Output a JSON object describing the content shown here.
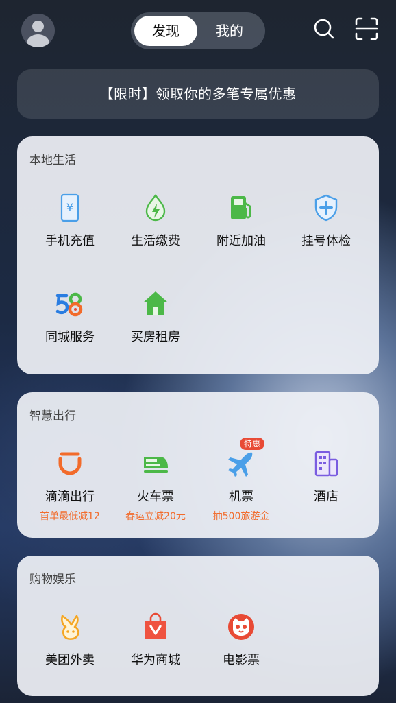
{
  "top": {
    "tabs": [
      {
        "label": "发现",
        "active": true
      },
      {
        "label": "我的",
        "active": false
      }
    ]
  },
  "promo": {
    "text": "【限时】领取你的多笔专属优惠"
  },
  "local": {
    "title": "本地生活",
    "items": [
      {
        "label": "手机充值",
        "icon": "phone-recharge-icon"
      },
      {
        "label": "生活缴费",
        "icon": "utility-payment-icon"
      },
      {
        "label": "附近加油",
        "icon": "gas-station-icon"
      },
      {
        "label": "挂号体检",
        "icon": "medical-shield-icon"
      },
      {
        "label": "同城服务",
        "icon": "58-logo-icon"
      },
      {
        "label": "买房租房",
        "icon": "house-icon"
      }
    ]
  },
  "travel": {
    "title": "智慧出行",
    "items": [
      {
        "label": "滴滴出行",
        "sub": "首单最低减12",
        "icon": "didi-icon"
      },
      {
        "label": "火车票",
        "sub": "春运立减20元",
        "icon": "train-icon"
      },
      {
        "label": "机票",
        "sub": "抽500旅游金",
        "icon": "plane-icon",
        "badge": "特惠"
      },
      {
        "label": "酒店",
        "icon": "hotel-icon"
      }
    ]
  },
  "shopping": {
    "title": "购物娱乐",
    "items": [
      {
        "label": "美团外卖",
        "icon": "meituan-waimai-icon"
      },
      {
        "label": "华为商城",
        "icon": "shopping-bag-icon"
      },
      {
        "label": "电影票",
        "icon": "movie-cat-icon"
      }
    ]
  },
  "colors": {
    "accent_orange": "#f26b2b",
    "badge_red": "#e84a35",
    "green": "#4cb848",
    "blue": "#4a9fe8",
    "purple": "#7a5ce0"
  }
}
